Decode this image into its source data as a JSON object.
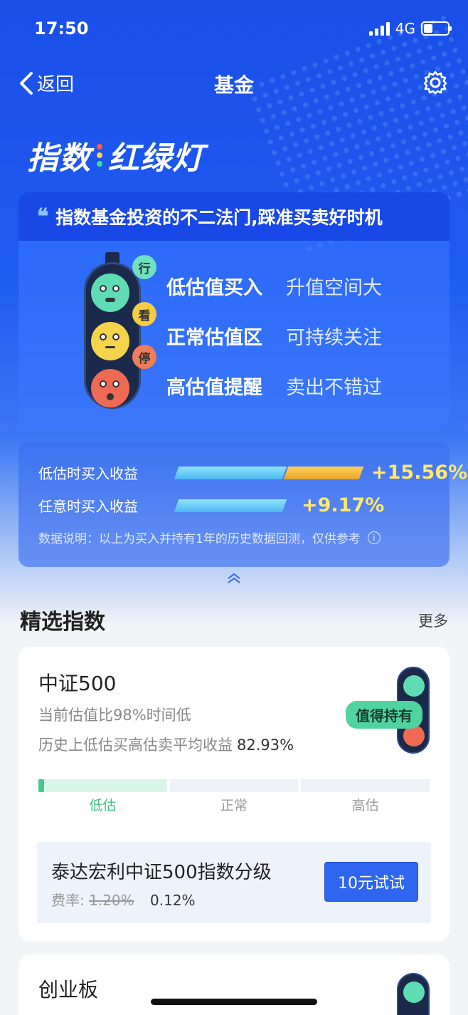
{
  "status": {
    "time": "17:50",
    "network": "4G"
  },
  "nav": {
    "back_label": "返回",
    "title": "基金"
  },
  "hero": {
    "title_left": "指数",
    "title_right": "红绿灯"
  },
  "intro": {
    "headline": "指数基金投资的不二法门,踩准买卖好时机",
    "bubbles": [
      "行",
      "看",
      "停"
    ],
    "rows": [
      {
        "key": "低估值买入",
        "value": "升值空间大"
      },
      {
        "key": "正常估值区",
        "value": "可持续关注"
      },
      {
        "key": "高估值提醒",
        "value": "卖出不错过"
      }
    ]
  },
  "returns": {
    "low_label": "低估时买入收益",
    "low_pct": "+15.56%",
    "any_label": "任意时买入收益",
    "any_pct": "+9.17%",
    "note": "数据说明：以上为买入并持有1年的历史数据回测，仅供参考",
    "bars": {
      "low_value": 15.56,
      "any_value": 9.17
    }
  },
  "section": {
    "title": "精选指数",
    "more": "更多"
  },
  "cards": [
    {
      "name": "中证500",
      "desc1": "当前估值比98%时间低",
      "desc2_label": "历史上低估买高估卖平均收益",
      "desc2_value": "82.93%",
      "tag": "值得持有",
      "scale": [
        "低估",
        "正常",
        "高估"
      ],
      "fund_name": "泰达宏利中证500指数分级",
      "fee_label": "费率:",
      "fee_old": "1.20%",
      "fee_new": "0.12%",
      "cta": "10元试试"
    },
    {
      "name": "创业板"
    }
  ],
  "colors": {
    "primary": "#1f5cf2",
    "green": "#45c98f",
    "gold": "#ffe86b",
    "cta": "#2f66f0"
  }
}
